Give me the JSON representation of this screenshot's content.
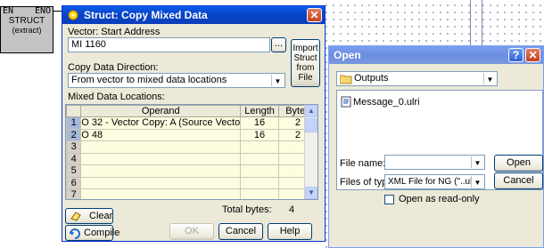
{
  "canvas": {
    "block": {
      "in_pin": "EN",
      "out_pin": "ENO",
      "title": "STRUCT",
      "subtitle": "(extract)"
    }
  },
  "struct_dialog": {
    "title": "Struct: Copy Mixed Data",
    "vector_label": "Vector: Start Address",
    "vector_value": "MI 1160",
    "browse_label": "...",
    "import_label": "Import Struct from File",
    "direction_label": "Copy Data Direction:",
    "direction_value": "From vector to mixed data locations",
    "locations_label": "Mixed Data Locations:",
    "columns": [
      "",
      "Operand",
      "Length",
      "Bytes"
    ],
    "rows": [
      {
        "n": "1",
        "operand": "O 32 - Vector Copy: A (Source Vecto",
        "length": "16",
        "bytes": "2"
      },
      {
        "n": "2",
        "operand": "O 48",
        "length": "16",
        "bytes": "2"
      },
      {
        "n": "3",
        "operand": "",
        "length": "",
        "bytes": ""
      },
      {
        "n": "4",
        "operand": "",
        "length": "",
        "bytes": ""
      },
      {
        "n": "5",
        "operand": "",
        "length": "",
        "bytes": ""
      },
      {
        "n": "6",
        "operand": "",
        "length": "",
        "bytes": ""
      },
      {
        "n": "7",
        "operand": "",
        "length": "",
        "bytes": ""
      }
    ],
    "total_label": "Total bytes:",
    "total_value": "4",
    "clear_label": "Clear",
    "compile_label": "Compile",
    "ok_label": "OK",
    "cancel_label": "Cancel",
    "help_label": "Help"
  },
  "open_dialog": {
    "title": "Open",
    "help_btn": "?",
    "close_btn": "✕",
    "folder": "Outputs",
    "files": [
      "Message_0.ulri"
    ],
    "filename_label": "File name:",
    "filename_value": "",
    "filetype_label": "Files of type",
    "filetype_value": "XML File for NG (\"..ulri)",
    "readonly_label": "Open as read-only",
    "open_label": "Open",
    "cancel_label": "Cancel"
  },
  "colors": {
    "title_active": "#0845cc",
    "title_inactive": "#7b9ff0",
    "dialog_face": "#ece9d8",
    "grid_cell": "#fffde0"
  }
}
